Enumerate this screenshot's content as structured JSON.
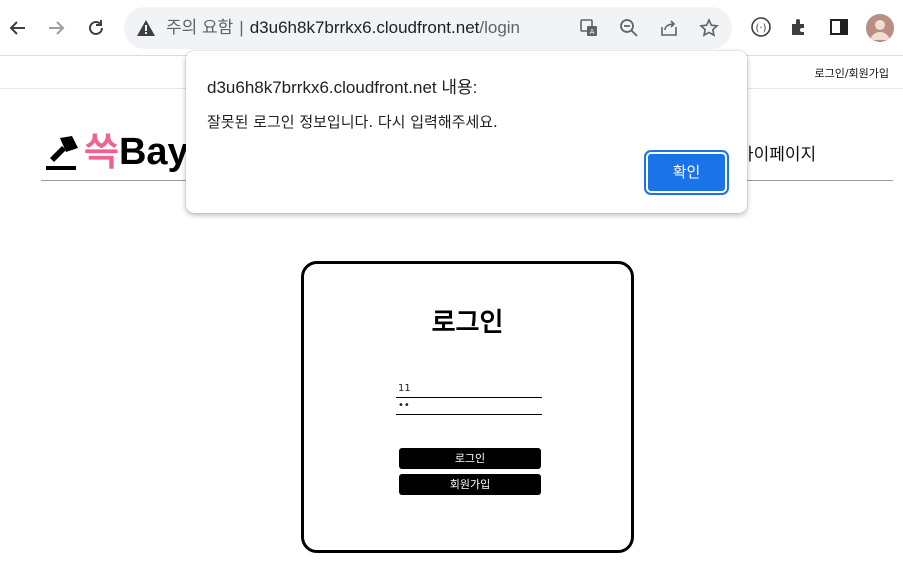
{
  "browser": {
    "security_warning": "주의 요함",
    "separator": "|",
    "host": "d3u6h8k7brrkx6.cloudfront.net",
    "path": "/login",
    "icons": [
      "back-icon",
      "forward-icon",
      "reload-icon",
      "warning-icon",
      "translate-icon",
      "zoom-out-icon",
      "share-icon",
      "star-icon",
      "extension-circle-icon",
      "puzzle-icon",
      "side-panel-icon",
      "profile-avatar"
    ]
  },
  "page": {
    "top_links": "로그인/회원가입",
    "logo_pink": "쓱",
    "logo_black": "Bay",
    "nav_mypage": "마이페이지",
    "login": {
      "title": "로그인",
      "id_value": "11",
      "password_value": "••",
      "login_button": "로그인",
      "signup_button": "회원가입"
    }
  },
  "dialog": {
    "title": "d3u6h8k7brrkx6.cloudfront.net 내용:",
    "message": "잘못된 로그인 정보입니다. 다시 입력해주세요.",
    "ok_label": "확인",
    "accent": "#1a73e8"
  },
  "colors": {
    "logo_pink": "#f06090"
  }
}
